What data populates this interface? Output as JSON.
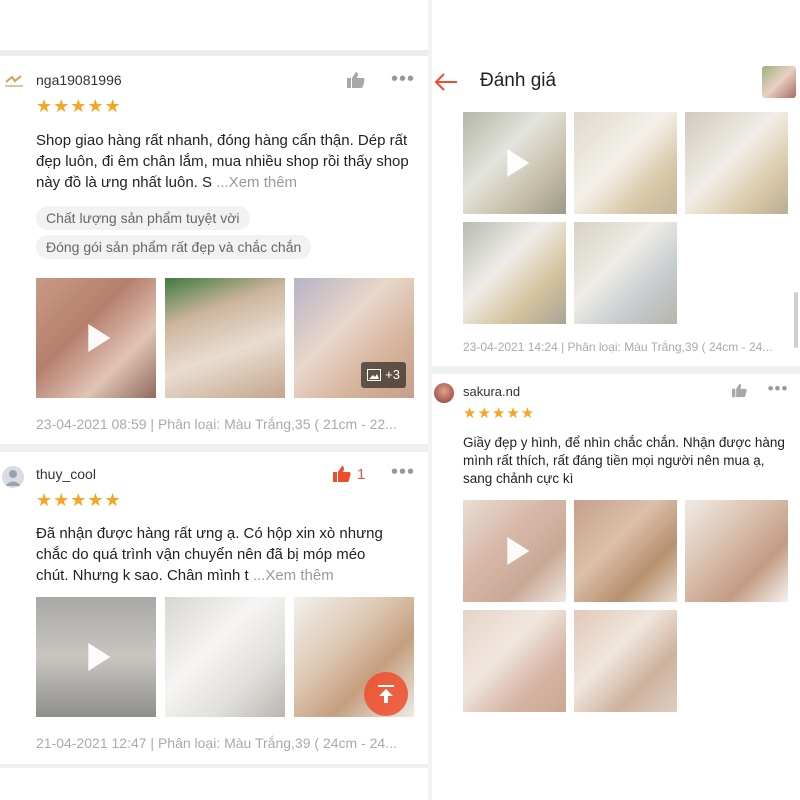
{
  "left": {
    "reviews": [
      {
        "username": "nga19081996",
        "stars": "★★★★★",
        "text": "Shop giao hàng rất nhanh, đóng hàng cẩn thận. Dép rất đẹp luôn, đi êm chân lắm, mua nhiều shop rồi thấy shop này đồ là ưng nhất luôn. S",
        "more_label": "...Xem thêm",
        "tags": [
          "Chất lượng sản phẩm tuyệt vời",
          "Đóng gói sản phẩm rất đẹp và chắc chắn"
        ],
        "extra_photos": "+3",
        "meta": "23-04-2021 08:59 | Phân loại: Màu Trắng,35 ( 21cm - 22..."
      },
      {
        "username": "thuy_cool",
        "likes": "1",
        "stars": "★★★★★",
        "text": "Đã nhận được hàng rất ưng ạ. Có hộp xin xò nhưng chắc do quá trình vận chuyển nên đã bị móp méo  chút. Nhưng k sao. Chân mình t",
        "more_label": "...Xem thêm",
        "meta": "21-04-2021 12:47 | Phân loại: Màu Trắng,39 ( 24cm - 24..."
      }
    ]
  },
  "right": {
    "title": "Đánh giá",
    "first_meta": "23-04-2021 14:24 | Phân loại: Màu Trắng,39 ( 24cm - 24...",
    "review": {
      "username": "sakura.nd",
      "stars": "★★★★★",
      "text": "Giầy đẹp y hình, để nhìn chắc chắn. Nhận được hàng mình rất thích, rất đáng tiền mọi người nên mua ạ, sang chảnh cực kì"
    }
  },
  "colors": {
    "accent": "#ee4d2d",
    "star": "#f5a623",
    "meta_text": "#aaaaaa"
  }
}
